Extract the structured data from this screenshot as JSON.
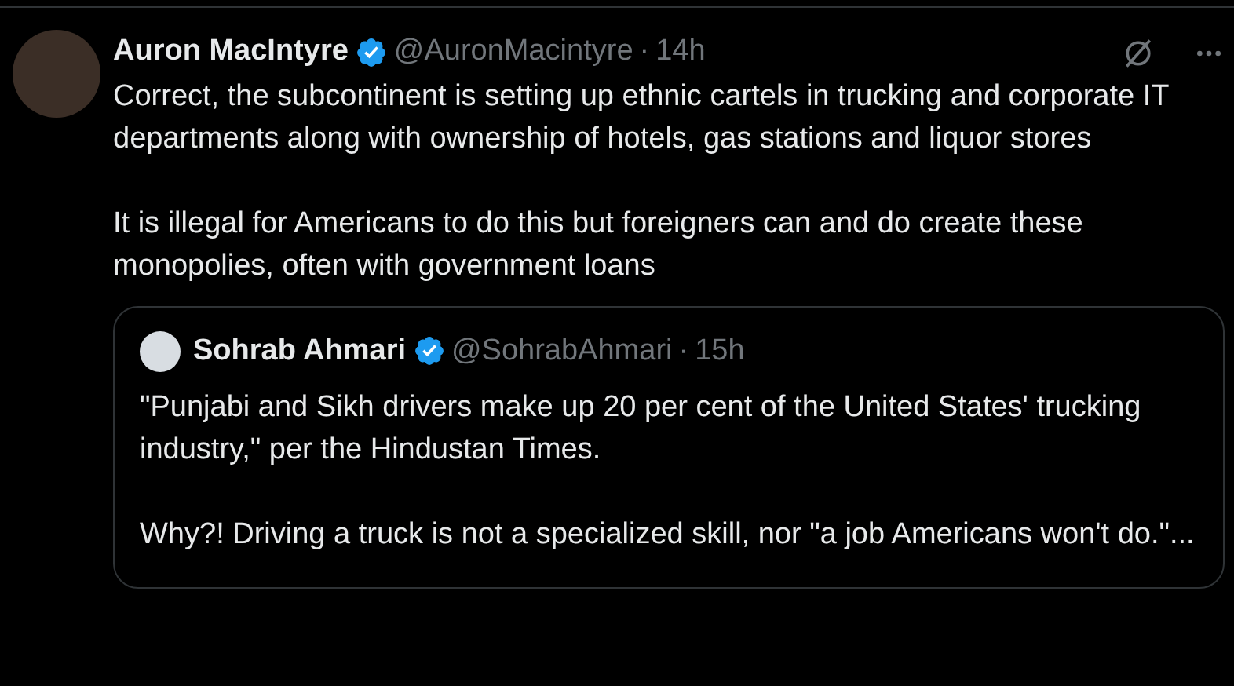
{
  "tweet": {
    "author": {
      "name": "Auron MacIntyre",
      "verified": true,
      "handle": "@AuronMacintyre",
      "separator": "·",
      "time": "14h"
    },
    "paragraphs": [
      "Correct, the subcontinent is setting up ethnic cartels in trucking and corporate IT departments along with ownership of hotels, gas stations and liquor stores",
      "It is illegal for Americans to do this but foreigners can and do create these monopolies, often with government loans"
    ],
    "quoted": {
      "author": {
        "name": "Sohrab Ahmari",
        "verified": true,
        "handle": "@SohrabAhmari",
        "separator": "·",
        "time": "15h"
      },
      "paragraphs": [
        "\"Punjabi and Sikh drivers make up 20 per cent of the United States' trucking industry,\" per the Hindustan Times.",
        "Why?! Driving a truck is not a specialized skill, nor \"a job Americans won't do.\"..."
      ]
    }
  }
}
